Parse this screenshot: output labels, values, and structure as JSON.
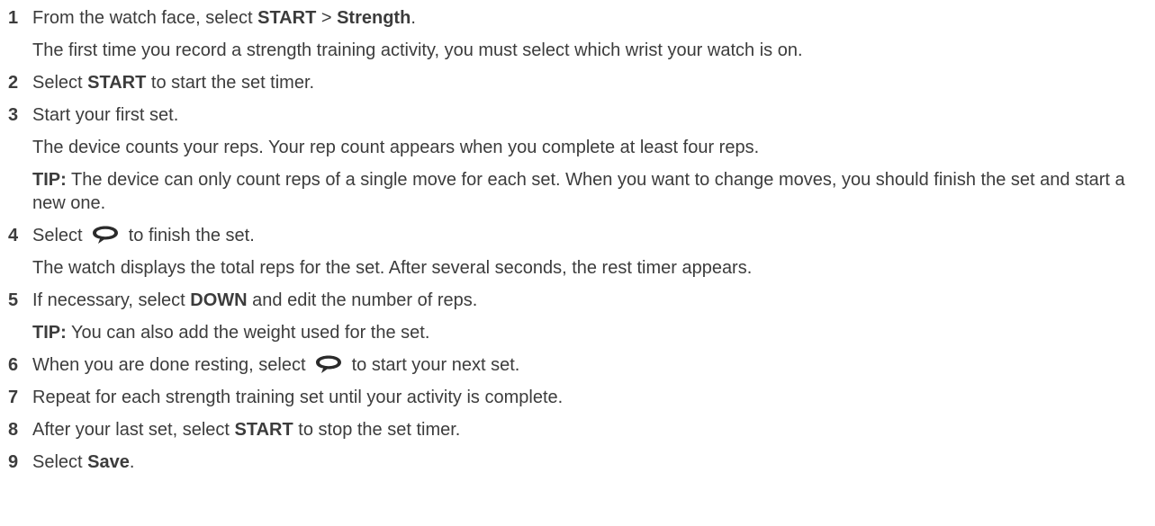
{
  "steps": [
    {
      "num": "1",
      "pre": "From the watch face, select ",
      "b1": "START",
      "mid": " > ",
      "b2": "Strength",
      "post": ".",
      "note": "The first time you record a strength training activity, you must select which wrist your watch is on."
    },
    {
      "num": "2",
      "pre": "Select ",
      "b1": "START",
      "post": " to start the set timer."
    },
    {
      "num": "3",
      "text": "Start your first set.",
      "note": "The device counts your reps. Your rep count appears when you complete at least four reps.",
      "tip_label": "TIP:",
      "tip": " The device can only count reps of a single move for each set. When you want to change moves, you should finish the set and start a new one."
    },
    {
      "num": "4",
      "pre": "Select ",
      "icon": "lap-icon",
      "post": " to finish the set.",
      "note": "The watch displays the total reps for the set. After several seconds, the rest timer appears."
    },
    {
      "num": "5",
      "pre": "If necessary, select ",
      "b1": "DOWN",
      "post": " and edit the number of reps.",
      "tip_label": "TIP:",
      "tip": " You can also add the weight used for the set."
    },
    {
      "num": "6",
      "pre": "When you are done resting, select ",
      "icon": "lap-icon",
      "post": " to start your next set."
    },
    {
      "num": "7",
      "text": "Repeat for each strength training set until your activity is complete."
    },
    {
      "num": "8",
      "pre": "After your last set, select ",
      "b1": "START",
      "post": " to stop the set timer."
    },
    {
      "num": "9",
      "pre": "Select ",
      "b1": "Save",
      "post": "."
    }
  ],
  "colors": {
    "text": "#3c3c3c",
    "icon": "#2b2b2b"
  }
}
